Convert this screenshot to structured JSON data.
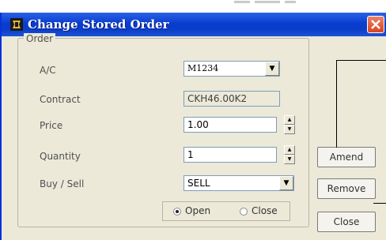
{
  "window": {
    "title": "Change Stored Order",
    "app_icon": "ticket-app-icon",
    "close_icon": "close-x-icon"
  },
  "order_group": {
    "legend": "Order",
    "ac": {
      "label": "A/C",
      "value": "M1234"
    },
    "contract": {
      "label": "Contract",
      "value": "CKH46.00K2"
    },
    "price": {
      "label": "Price",
      "value": "1.00"
    },
    "quantity": {
      "label": "Quantity",
      "value": "1"
    },
    "buy_sell": {
      "label": "Buy / Sell",
      "value": "SELL"
    },
    "position": {
      "open_label": "Open",
      "close_label": "Close",
      "selected": "Open"
    }
  },
  "buttons": {
    "amend": "Amend",
    "remove": "Remove",
    "close": "Close"
  },
  "colors": {
    "titlebar": "#0a3dc8",
    "dialog_bg": "#ece9d8",
    "close_button": "#d9431f"
  }
}
